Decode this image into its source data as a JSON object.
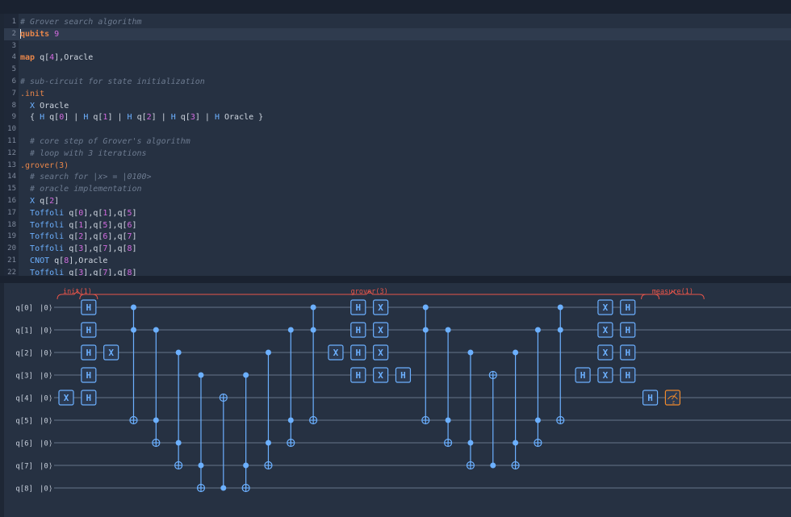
{
  "editor": {
    "lines": [
      {
        "n": "1",
        "tokens": [
          {
            "t": "# Grover search algorithm",
            "c": "comment"
          }
        ]
      },
      {
        "n": "2",
        "active": true,
        "tokens": [
          {
            "t": "qubits",
            "c": "kw"
          },
          {
            "t": " ",
            "c": "id"
          },
          {
            "t": "9",
            "c": "num"
          }
        ]
      },
      {
        "n": "3",
        "tokens": []
      },
      {
        "n": "4",
        "tokens": [
          {
            "t": "map",
            "c": "kw"
          },
          {
            "t": " q[",
            "c": "id"
          },
          {
            "t": "4",
            "c": "num"
          },
          {
            "t": "],Oracle",
            "c": "id"
          }
        ]
      },
      {
        "n": "5",
        "tokens": []
      },
      {
        "n": "6",
        "tokens": [
          {
            "t": "# sub-circuit for state initialization",
            "c": "comment"
          }
        ]
      },
      {
        "n": "7",
        "tokens": [
          {
            "t": ".init",
            "c": "sub"
          }
        ]
      },
      {
        "n": "8",
        "tokens": [
          {
            "t": "  ",
            "c": "id"
          },
          {
            "t": "X",
            "c": "gate"
          },
          {
            "t": " Oracle",
            "c": "id"
          }
        ]
      },
      {
        "n": "9",
        "tokens": [
          {
            "t": "  { ",
            "c": "id"
          },
          {
            "t": "H",
            "c": "gate"
          },
          {
            "t": " q[",
            "c": "id"
          },
          {
            "t": "0",
            "c": "num"
          },
          {
            "t": "] | ",
            "c": "id"
          },
          {
            "t": "H",
            "c": "gate"
          },
          {
            "t": " q[",
            "c": "id"
          },
          {
            "t": "1",
            "c": "num"
          },
          {
            "t": "] | ",
            "c": "id"
          },
          {
            "t": "H",
            "c": "gate"
          },
          {
            "t": " q[",
            "c": "id"
          },
          {
            "t": "2",
            "c": "num"
          },
          {
            "t": "] | ",
            "c": "id"
          },
          {
            "t": "H",
            "c": "gate"
          },
          {
            "t": " q[",
            "c": "id"
          },
          {
            "t": "3",
            "c": "num"
          },
          {
            "t": "] | ",
            "c": "id"
          },
          {
            "t": "H",
            "c": "gate"
          },
          {
            "t": " Oracle }",
            "c": "id"
          }
        ]
      },
      {
        "n": "10",
        "tokens": []
      },
      {
        "n": "11",
        "tokens": [
          {
            "t": "  # core step of Grover's algorithm",
            "c": "comment"
          }
        ]
      },
      {
        "n": "12",
        "tokens": [
          {
            "t": "  # loop with 3 iterations",
            "c": "comment"
          }
        ]
      },
      {
        "n": "13",
        "tokens": [
          {
            "t": ".grover(3)",
            "c": "sub"
          }
        ]
      },
      {
        "n": "14",
        "tokens": [
          {
            "t": "  # search for |x> = |0100>",
            "c": "comment"
          }
        ]
      },
      {
        "n": "15",
        "tokens": [
          {
            "t": "  # oracle implementation",
            "c": "comment"
          }
        ]
      },
      {
        "n": "16",
        "tokens": [
          {
            "t": "  ",
            "c": "id"
          },
          {
            "t": "X",
            "c": "gate"
          },
          {
            "t": " q[",
            "c": "id"
          },
          {
            "t": "2",
            "c": "num"
          },
          {
            "t": "]",
            "c": "id"
          }
        ]
      },
      {
        "n": "17",
        "tokens": [
          {
            "t": "  ",
            "c": "id"
          },
          {
            "t": "Toffoli",
            "c": "gate"
          },
          {
            "t": " q[",
            "c": "id"
          },
          {
            "t": "0",
            "c": "num"
          },
          {
            "t": "],q[",
            "c": "id"
          },
          {
            "t": "1",
            "c": "num"
          },
          {
            "t": "],q[",
            "c": "id"
          },
          {
            "t": "5",
            "c": "num"
          },
          {
            "t": "]",
            "c": "id"
          }
        ]
      },
      {
        "n": "18",
        "tokens": [
          {
            "t": "  ",
            "c": "id"
          },
          {
            "t": "Toffoli",
            "c": "gate"
          },
          {
            "t": " q[",
            "c": "id"
          },
          {
            "t": "1",
            "c": "num"
          },
          {
            "t": "],q[",
            "c": "id"
          },
          {
            "t": "5",
            "c": "num"
          },
          {
            "t": "],q[",
            "c": "id"
          },
          {
            "t": "6",
            "c": "num"
          },
          {
            "t": "]",
            "c": "id"
          }
        ]
      },
      {
        "n": "19",
        "tokens": [
          {
            "t": "  ",
            "c": "id"
          },
          {
            "t": "Toffoli",
            "c": "gate"
          },
          {
            "t": " q[",
            "c": "id"
          },
          {
            "t": "2",
            "c": "num"
          },
          {
            "t": "],q[",
            "c": "id"
          },
          {
            "t": "6",
            "c": "num"
          },
          {
            "t": "],q[",
            "c": "id"
          },
          {
            "t": "7",
            "c": "num"
          },
          {
            "t": "]",
            "c": "id"
          }
        ]
      },
      {
        "n": "20",
        "tokens": [
          {
            "t": "  ",
            "c": "id"
          },
          {
            "t": "Toffoli",
            "c": "gate"
          },
          {
            "t": " q[",
            "c": "id"
          },
          {
            "t": "3",
            "c": "num"
          },
          {
            "t": "],q[",
            "c": "id"
          },
          {
            "t": "7",
            "c": "num"
          },
          {
            "t": "],q[",
            "c": "id"
          },
          {
            "t": "8",
            "c": "num"
          },
          {
            "t": "]",
            "c": "id"
          }
        ]
      },
      {
        "n": "21",
        "tokens": [
          {
            "t": "  ",
            "c": "id"
          },
          {
            "t": "CNOT",
            "c": "gate"
          },
          {
            "t": " q[",
            "c": "id"
          },
          {
            "t": "8",
            "c": "num"
          },
          {
            "t": "],Oracle",
            "c": "id"
          }
        ]
      },
      {
        "n": "22",
        "tokens": [
          {
            "t": "  ",
            "c": "id"
          },
          {
            "t": "Toffoli",
            "c": "gate"
          },
          {
            "t": " q[",
            "c": "id"
          },
          {
            "t": "3",
            "c": "num"
          },
          {
            "t": "],q[",
            "c": "id"
          },
          {
            "t": "7",
            "c": "num"
          },
          {
            "t": "],q[",
            "c": "id"
          },
          {
            "t": "8",
            "c": "num"
          },
          {
            "t": "]",
            "c": "id"
          }
        ]
      }
    ]
  },
  "circuit": {
    "qubits": [
      "q[0]",
      "q[1]",
      "q[2]",
      "q[3]",
      "q[4]",
      "q[5]",
      "q[6]",
      "q[7]",
      "q[8]"
    ],
    "initial_state": "|0⟩",
    "sections": [
      {
        "label": "init(1)",
        "from_col": 0,
        "to_col": 1
      },
      {
        "label": "grover(3)",
        "from_col": 1,
        "to_col": 26
      },
      {
        "label": "measure(1)",
        "from_col": 26,
        "to_col": 28
      }
    ],
    "gates": [
      {
        "type": "X",
        "col": 0,
        "qubit": 4
      },
      {
        "type": "H",
        "col": 1,
        "qubit": 0
      },
      {
        "type": "H",
        "col": 1,
        "qubit": 1
      },
      {
        "type": "H",
        "col": 1,
        "qubit": 2
      },
      {
        "type": "H",
        "col": 1,
        "qubit": 3
      },
      {
        "type": "H",
        "col": 1,
        "qubit": 4
      },
      {
        "type": "X",
        "col": 2,
        "qubit": 2
      },
      {
        "type": "ctrl",
        "col": 3,
        "controls": [
          0,
          1
        ],
        "target": 5
      },
      {
        "type": "ctrl",
        "col": 4,
        "controls": [
          1,
          5
        ],
        "target": 6
      },
      {
        "type": "ctrl",
        "col": 5,
        "controls": [
          2,
          6
        ],
        "target": 7
      },
      {
        "type": "ctrl",
        "col": 6,
        "controls": [
          3,
          7
        ],
        "target": 8
      },
      {
        "type": "ctrl",
        "col": 7,
        "controls": [
          8
        ],
        "target": 4
      },
      {
        "type": "ctrl",
        "col": 8,
        "controls": [
          3,
          7
        ],
        "target": 8
      },
      {
        "type": "ctrl",
        "col": 9,
        "controls": [
          2,
          6
        ],
        "target": 7
      },
      {
        "type": "ctrl",
        "col": 10,
        "controls": [
          1,
          5
        ],
        "target": 6
      },
      {
        "type": "ctrl",
        "col": 11,
        "controls": [
          0,
          1
        ],
        "target": 5
      },
      {
        "type": "X",
        "col": 12,
        "qubit": 2
      },
      {
        "type": "H",
        "col": 13,
        "qubit": 0
      },
      {
        "type": "H",
        "col": 13,
        "qubit": 1
      },
      {
        "type": "H",
        "col": 13,
        "qubit": 2
      },
      {
        "type": "H",
        "col": 13,
        "qubit": 3
      },
      {
        "type": "X",
        "col": 14,
        "qubit": 0
      },
      {
        "type": "X",
        "col": 14,
        "qubit": 1
      },
      {
        "type": "X",
        "col": 14,
        "qubit": 2
      },
      {
        "type": "X",
        "col": 14,
        "qubit": 3
      },
      {
        "type": "H",
        "col": 15,
        "qubit": 3
      },
      {
        "type": "ctrl",
        "col": 16,
        "controls": [
          0,
          1
        ],
        "target": 5
      },
      {
        "type": "ctrl",
        "col": 17,
        "controls": [
          1,
          5
        ],
        "target": 6
      },
      {
        "type": "ctrl",
        "col": 18,
        "controls": [
          2,
          6
        ],
        "target": 7
      },
      {
        "type": "ctrl",
        "col": 19,
        "controls": [
          7
        ],
        "target": 3
      },
      {
        "type": "ctrl",
        "col": 20,
        "controls": [
          2,
          6
        ],
        "target": 7
      },
      {
        "type": "ctrl",
        "col": 21,
        "controls": [
          1,
          5
        ],
        "target": 6
      },
      {
        "type": "ctrl",
        "col": 22,
        "controls": [
          0,
          1
        ],
        "target": 5
      },
      {
        "type": "H",
        "col": 23,
        "qubit": 3
      },
      {
        "type": "X",
        "col": 24,
        "qubit": 0
      },
      {
        "type": "X",
        "col": 24,
        "qubit": 1
      },
      {
        "type": "X",
        "col": 24,
        "qubit": 2
      },
      {
        "type": "X",
        "col": 24,
        "qubit": 3
      },
      {
        "type": "H",
        "col": 25,
        "qubit": 0
      },
      {
        "type": "H",
        "col": 25,
        "qubit": 1
      },
      {
        "type": "H",
        "col": 25,
        "qubit": 2
      },
      {
        "type": "H",
        "col": 25,
        "qubit": 3
      },
      {
        "type": "H",
        "col": 26,
        "qubit": 4
      },
      {
        "type": "M",
        "col": 27,
        "qubit": 4,
        "label": "z"
      }
    ]
  },
  "colors": {
    "wire": "#66758a",
    "gate": "#6cb0ff",
    "gate_fill": "#2b3a52",
    "section": "#e8554a",
    "measure": "#f08a2c",
    "label": "#c8d0dc"
  },
  "icons": {
    "measure": "measure-meter-icon"
  }
}
